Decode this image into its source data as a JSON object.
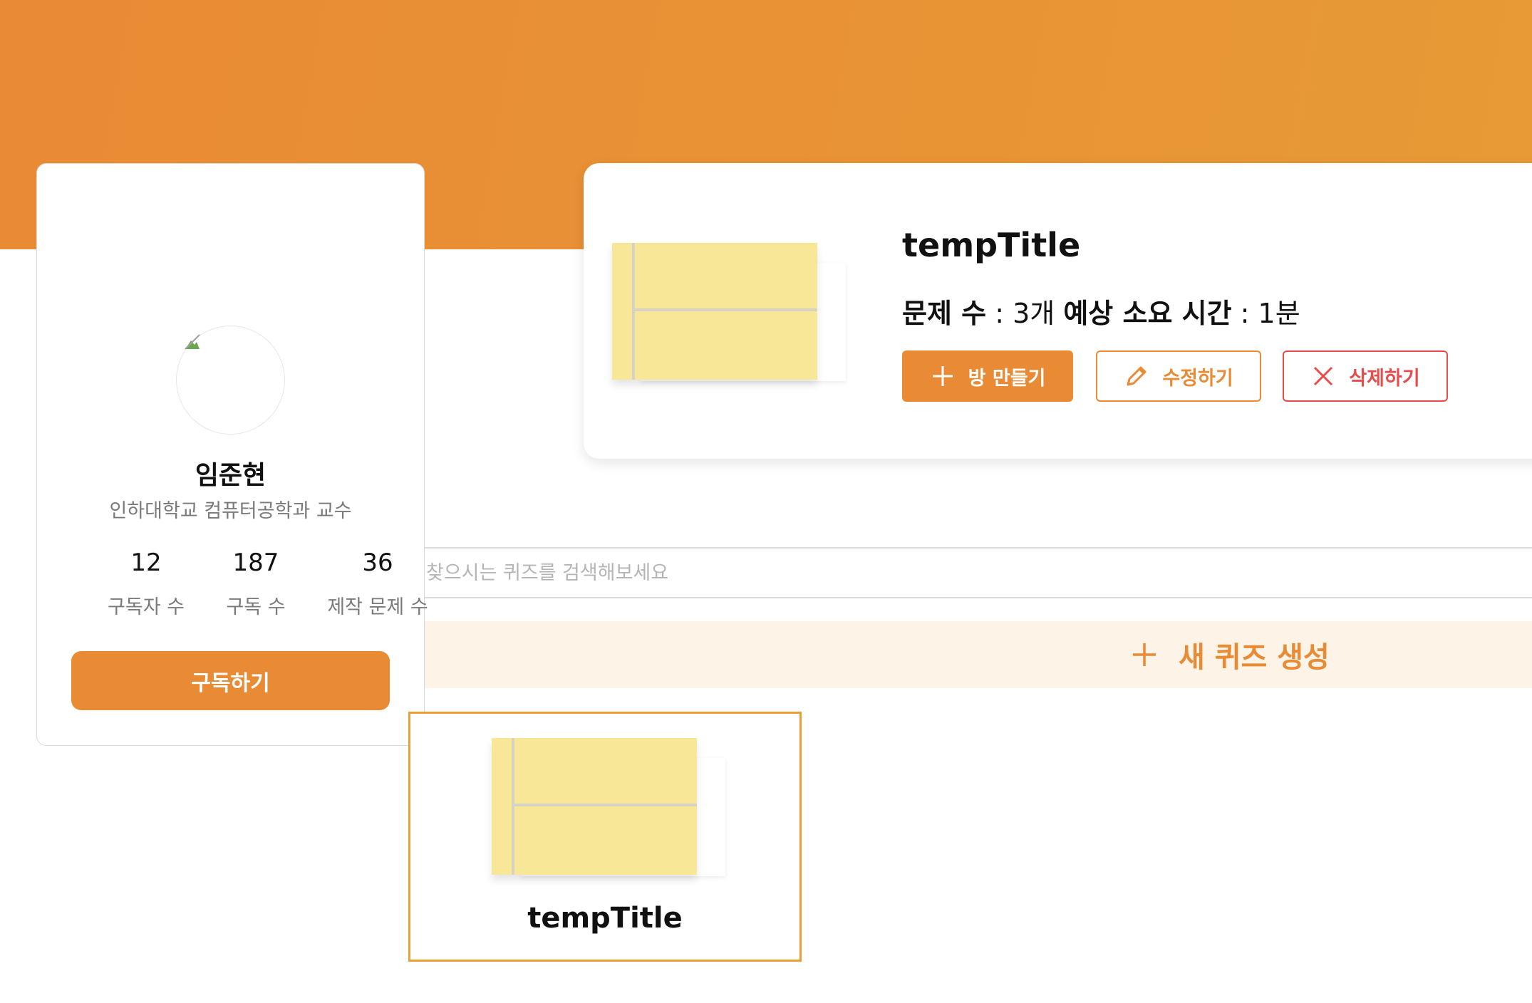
{
  "profile": {
    "name": "임준현",
    "role": "인하대학교 컴퓨터공학과 교수",
    "stats": [
      {
        "value": "12",
        "label": "구독자 수"
      },
      {
        "value": "187",
        "label": "구독 수"
      },
      {
        "value": "36",
        "label": "제작 문제 수"
      }
    ],
    "subscribe_label": "구독하기"
  },
  "detail": {
    "title": "tempTitle",
    "question_count_label": "문제 수",
    "question_count_value": "3개",
    "time_label": "예상 소요 시간",
    "time_value": "1분",
    "separator": ":",
    "make_room_label": "방 만들기",
    "edit_label": "수정하기",
    "delete_label": "삭제하기"
  },
  "search": {
    "placeholder": "찾으시는 퀴즈를 검색해보세요"
  },
  "new_quiz_label": "새 퀴즈 생성",
  "quiz_list": [
    {
      "title": "tempTitle"
    }
  ],
  "colors": {
    "accent": "#e98a34",
    "danger": "#e74c4c",
    "thumbnail": "#f7e796",
    "new_quiz_bg": "#fdf3e6"
  },
  "icons": {
    "add": "plus-icon",
    "edit": "pencil-icon",
    "delete": "close-icon",
    "avatar": "broken-image-icon"
  }
}
